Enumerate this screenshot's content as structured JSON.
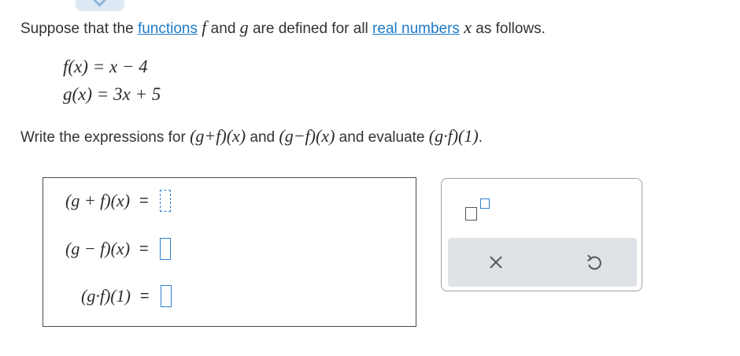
{
  "intro": {
    "prefix": "Suppose that the ",
    "link_functions": "functions",
    "f": "f",
    "and1": " and ",
    "g": "g",
    "middle": " are defined for all ",
    "link_real_numbers": "real numbers",
    "x": "x",
    "suffix": " as follows."
  },
  "definitions": {
    "f_def": "f(x) = x − 4",
    "g_def": "g(x) = 3x + 5"
  },
  "instruction": {
    "prefix": "Write the expressions for ",
    "expr_sum": "(g+f)(x)",
    "and": " and ",
    "expr_diff": "(g−f)(x)",
    "mid": " and evaluate ",
    "expr_prod": "(g·f)(1)",
    "suffix": "."
  },
  "answers": {
    "sum_label": "(g + f)(x)",
    "diff_label": "(g − f)(x)",
    "prod_label": "(g·f)(1)",
    "equals": "=",
    "sum_value": "",
    "diff_value": "",
    "prod_value": ""
  },
  "toolbar": {
    "superscript_icon": "superscript-icon",
    "clear_icon": "clear-x-icon",
    "undo_icon": "undo-icon"
  },
  "colors": {
    "link": "#1f7ac8",
    "input_border": "#2f7fd0",
    "action_bar": "#dfe3e7",
    "tab": "#dce9f5"
  }
}
